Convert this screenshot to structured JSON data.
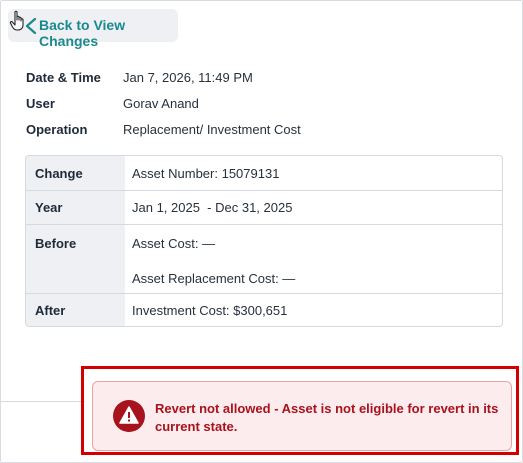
{
  "header": {
    "back_label": "Back to View Changes"
  },
  "meta": {
    "date_label": "Date & Time",
    "date_value": "Jan 7, 2026, 11:49 PM",
    "user_label": "User",
    "user_value": "Gorav Anand",
    "operation_label": "Operation",
    "operation_value": "Replacement/ Investment Cost"
  },
  "changes": {
    "change_label": "Change",
    "change_value": "Asset Number: 15079131",
    "year_label": "Year",
    "year_value": "Jan 1, 2025  - Dec 31, 2025",
    "before_label": "Before",
    "before_line1": "Asset Cost: —",
    "before_line2": "Asset Replacement Cost: —",
    "after_label": "After",
    "after_value": "Investment Cost: $300,651"
  },
  "alert": {
    "message": "Revert not allowed - Asset is not eligible for revert in its current state.",
    "icon": "warning-icon"
  },
  "colors": {
    "accent": "#1a8a8f",
    "error": "#a8121c",
    "error_bg": "#fdecee",
    "highlight": "#d40000"
  }
}
